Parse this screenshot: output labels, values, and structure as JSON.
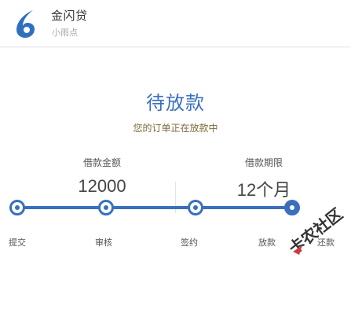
{
  "header": {
    "brand_name": "金闪贷",
    "brand_sub": "小雨点",
    "logo_color": "#2f6fbf"
  },
  "status": {
    "title": "待放款",
    "subtitle": "您的订单正在放款中"
  },
  "loan": {
    "amount_label": "借款金额",
    "amount_value": "12000",
    "term_label": "借款期限",
    "term_value": "12个月"
  },
  "progress": {
    "steps": [
      {
        "label": "提交",
        "state": "done"
      },
      {
        "label": "审核",
        "state": "done"
      },
      {
        "label": "签约",
        "state": "done"
      },
      {
        "label": "放款",
        "state": "current"
      },
      {
        "label": "还款",
        "state": "pending"
      }
    ],
    "accent_color": "#3a6fbe"
  },
  "watermark": {
    "text": "卡农社区"
  }
}
